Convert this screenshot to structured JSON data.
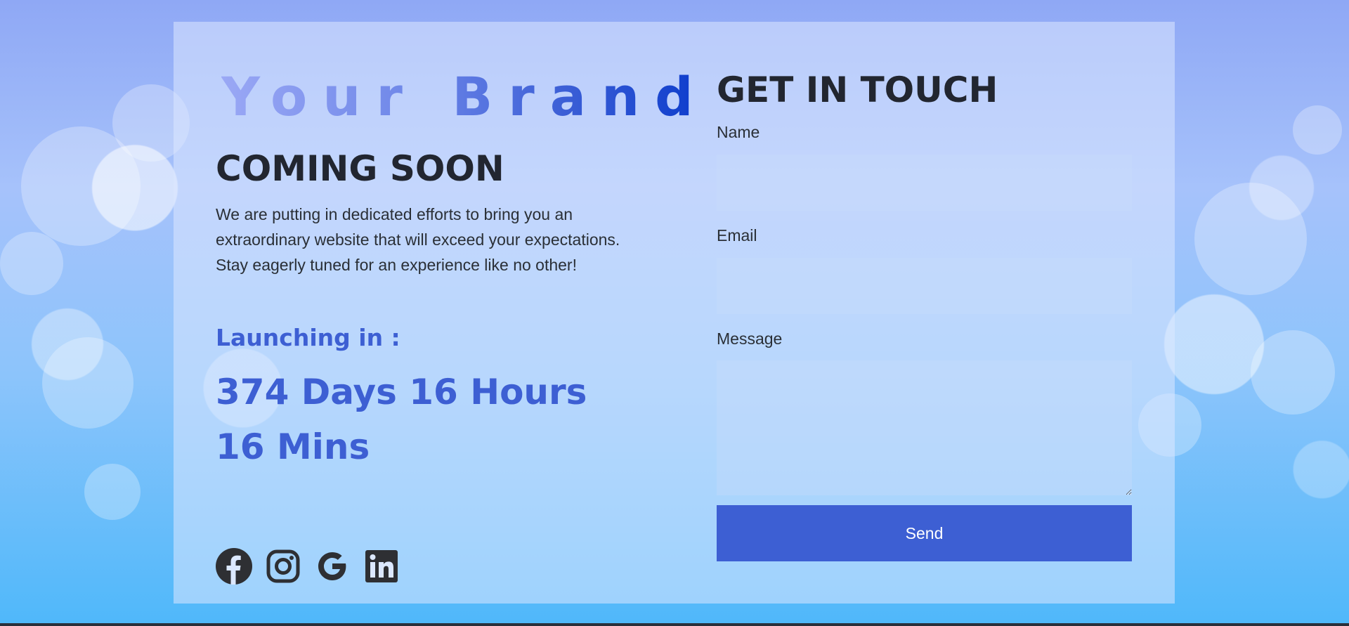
{
  "brand": {
    "name": "Your Brand"
  },
  "hero": {
    "title": "COMING SOON",
    "description": "We are putting in dedicated efforts to bring you an extraordinary website that will exceed your expectations. Stay eagerly tuned for an experience like no other!",
    "launch_label": "Launching in :",
    "countdown": "374 Days 16 Hours 16 Mins"
  },
  "socials": [
    {
      "icon": "facebook-icon"
    },
    {
      "icon": "instagram-icon"
    },
    {
      "icon": "google-icon"
    },
    {
      "icon": "linkedin-icon"
    }
  ],
  "contact": {
    "title": "GET IN TOUCH",
    "name_label": "Name",
    "name_value": "",
    "email_label": "Email",
    "email_value": "",
    "message_label": "Message",
    "message_value": "",
    "send_label": "Send"
  },
  "colors": {
    "accent": "#3d5fd3",
    "heading": "#222630",
    "brand_gradient": [
      "#9aa8f5",
      "#0b3bcc"
    ]
  }
}
